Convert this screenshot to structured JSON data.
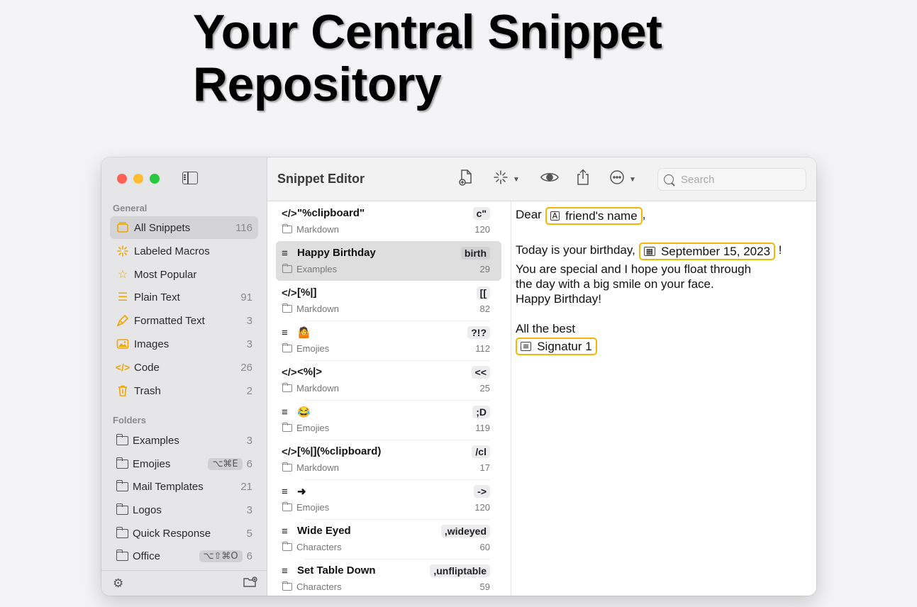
{
  "headline": {
    "line1": "Your Central Snippet",
    "line2": "Repository"
  },
  "toolbar": {
    "title": "Snippet Editor",
    "search_placeholder": "Search"
  },
  "sidebar": {
    "general_label": "General",
    "folders_label": "Folders",
    "general_items": [
      {
        "label": "All Snippets",
        "count": "116",
        "icon": "tray-icon"
      },
      {
        "label": "Labeled Macros",
        "count": "",
        "icon": "sparkle-icon"
      },
      {
        "label": "Most Popular",
        "count": "",
        "icon": "star-icon"
      },
      {
        "label": "Plain Text",
        "count": "91",
        "icon": "lines-icon"
      },
      {
        "label": "Formatted Text",
        "count": "3",
        "icon": "brush-icon"
      },
      {
        "label": "Images",
        "count": "3",
        "icon": "image-icon"
      },
      {
        "label": "Code",
        "count": "26",
        "icon": "code-icon"
      },
      {
        "label": "Trash",
        "count": "2",
        "icon": "trash-icon"
      }
    ],
    "folder_items": [
      {
        "label": "Examples",
        "count": "3",
        "shortcut": ""
      },
      {
        "label": "Emojies",
        "count": "6",
        "shortcut": "⌥⌘E"
      },
      {
        "label": "Mail Templates",
        "count": "21",
        "shortcut": ""
      },
      {
        "label": "Logos",
        "count": "3",
        "shortcut": ""
      },
      {
        "label": "Quick Response",
        "count": "5",
        "shortcut": ""
      },
      {
        "label": "Office",
        "count": "6",
        "shortcut": "⌥⇧⌘O"
      }
    ]
  },
  "snippets": [
    {
      "type": "</>",
      "title": "\"%clipboard\"",
      "abbr": "c\"",
      "folder": "Markdown",
      "uses": "120"
    },
    {
      "type": "≡",
      "title": "Happy Birthday",
      "abbr": "birth",
      "folder": "Examples",
      "uses": "29"
    },
    {
      "type": "</>",
      "title": "[%|]",
      "abbr": "[[",
      "folder": "Markdown",
      "uses": "82"
    },
    {
      "type": "≡",
      "title": "🤷",
      "abbr": "?!?",
      "folder": "Emojies",
      "uses": "112"
    },
    {
      "type": "</>",
      "title": "<%|>",
      "abbr": "<<",
      "folder": "Markdown",
      "uses": "25"
    },
    {
      "type": "≡",
      "title": "😂",
      "abbr": ";D",
      "folder": "Emojies",
      "uses": "119"
    },
    {
      "type": "</>",
      "title": "[%|](%clipboard)",
      "abbr": "/cl",
      "folder": "Markdown",
      "uses": "17"
    },
    {
      "type": "≡",
      "title": "➜",
      "abbr": "->",
      "folder": "Emojies",
      "uses": "120"
    },
    {
      "type": "≡",
      "title": "Wide Eyed",
      "abbr": ",wideyed",
      "folder": "Characters",
      "uses": "60"
    },
    {
      "type": "≡",
      "title": "Set Table Down",
      "abbr": ",unfliptable",
      "folder": "Characters",
      "uses": "59"
    }
  ],
  "editor": {
    "greeting": "Dear",
    "token_name": "friend's name",
    "comma": ",",
    "birthday_prefix": "Today is your birthday,",
    "token_date": "September 15, 2023",
    "exclaim": "!",
    "line3": "You are special and I hope you float through",
    "line4": "the day with a big smile on your face.",
    "line5": "Happy Birthday!",
    "closing": "All the best",
    "token_signature": "Signatur 1"
  },
  "colors": {
    "accent": "#f2b705",
    "selection": "#d4d4d6"
  }
}
